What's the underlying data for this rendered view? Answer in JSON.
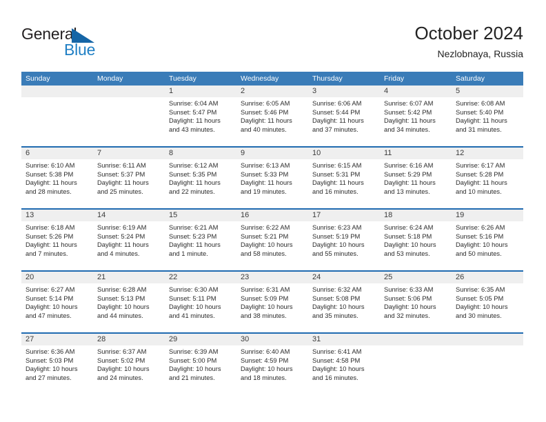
{
  "logo": {
    "word_one": "General",
    "word_two": "Blue",
    "triangle_color": "#1565a6",
    "blue_color": "#1f7fc4"
  },
  "header": {
    "title": "October 2024",
    "subtitle": "Nezlobnaya, Russia"
  },
  "theme": {
    "weekday_header_bg": "#3a7cb8",
    "week_separator": "#1f6ab0",
    "daynum_bg": "#efefef"
  },
  "weekdays": [
    "Sunday",
    "Monday",
    "Tuesday",
    "Wednesday",
    "Thursday",
    "Friday",
    "Saturday"
  ],
  "labels": {
    "sunrise": "Sunrise:",
    "sunset": "Sunset:",
    "daylight": "Daylight:"
  },
  "weeks": [
    [
      {
        "day": "",
        "sunrise": "",
        "sunset": "",
        "daylight": "",
        "empty": true
      },
      {
        "day": "",
        "sunrise": "",
        "sunset": "",
        "daylight": "",
        "empty": true
      },
      {
        "day": "1",
        "sunrise": "Sunrise: 6:04 AM",
        "sunset": "Sunset: 5:47 PM",
        "daylight": "Daylight: 11 hours and 43 minutes."
      },
      {
        "day": "2",
        "sunrise": "Sunrise: 6:05 AM",
        "sunset": "Sunset: 5:46 PM",
        "daylight": "Daylight: 11 hours and 40 minutes."
      },
      {
        "day": "3",
        "sunrise": "Sunrise: 6:06 AM",
        "sunset": "Sunset: 5:44 PM",
        "daylight": "Daylight: 11 hours and 37 minutes."
      },
      {
        "day": "4",
        "sunrise": "Sunrise: 6:07 AM",
        "sunset": "Sunset: 5:42 PM",
        "daylight": "Daylight: 11 hours and 34 minutes."
      },
      {
        "day": "5",
        "sunrise": "Sunrise: 6:08 AM",
        "sunset": "Sunset: 5:40 PM",
        "daylight": "Daylight: 11 hours and 31 minutes."
      }
    ],
    [
      {
        "day": "6",
        "sunrise": "Sunrise: 6:10 AM",
        "sunset": "Sunset: 5:38 PM",
        "daylight": "Daylight: 11 hours and 28 minutes."
      },
      {
        "day": "7",
        "sunrise": "Sunrise: 6:11 AM",
        "sunset": "Sunset: 5:37 PM",
        "daylight": "Daylight: 11 hours and 25 minutes."
      },
      {
        "day": "8",
        "sunrise": "Sunrise: 6:12 AM",
        "sunset": "Sunset: 5:35 PM",
        "daylight": "Daylight: 11 hours and 22 minutes."
      },
      {
        "day": "9",
        "sunrise": "Sunrise: 6:13 AM",
        "sunset": "Sunset: 5:33 PM",
        "daylight": "Daylight: 11 hours and 19 minutes."
      },
      {
        "day": "10",
        "sunrise": "Sunrise: 6:15 AM",
        "sunset": "Sunset: 5:31 PM",
        "daylight": "Daylight: 11 hours and 16 minutes."
      },
      {
        "day": "11",
        "sunrise": "Sunrise: 6:16 AM",
        "sunset": "Sunset: 5:29 PM",
        "daylight": "Daylight: 11 hours and 13 minutes."
      },
      {
        "day": "12",
        "sunrise": "Sunrise: 6:17 AM",
        "sunset": "Sunset: 5:28 PM",
        "daylight": "Daylight: 11 hours and 10 minutes."
      }
    ],
    [
      {
        "day": "13",
        "sunrise": "Sunrise: 6:18 AM",
        "sunset": "Sunset: 5:26 PM",
        "daylight": "Daylight: 11 hours and 7 minutes."
      },
      {
        "day": "14",
        "sunrise": "Sunrise: 6:19 AM",
        "sunset": "Sunset: 5:24 PM",
        "daylight": "Daylight: 11 hours and 4 minutes."
      },
      {
        "day": "15",
        "sunrise": "Sunrise: 6:21 AM",
        "sunset": "Sunset: 5:23 PM",
        "daylight": "Daylight: 11 hours and 1 minute."
      },
      {
        "day": "16",
        "sunrise": "Sunrise: 6:22 AM",
        "sunset": "Sunset: 5:21 PM",
        "daylight": "Daylight: 10 hours and 58 minutes."
      },
      {
        "day": "17",
        "sunrise": "Sunrise: 6:23 AM",
        "sunset": "Sunset: 5:19 PM",
        "daylight": "Daylight: 10 hours and 55 minutes."
      },
      {
        "day": "18",
        "sunrise": "Sunrise: 6:24 AM",
        "sunset": "Sunset: 5:18 PM",
        "daylight": "Daylight: 10 hours and 53 minutes."
      },
      {
        "day": "19",
        "sunrise": "Sunrise: 6:26 AM",
        "sunset": "Sunset: 5:16 PM",
        "daylight": "Daylight: 10 hours and 50 minutes."
      }
    ],
    [
      {
        "day": "20",
        "sunrise": "Sunrise: 6:27 AM",
        "sunset": "Sunset: 5:14 PM",
        "daylight": "Daylight: 10 hours and 47 minutes."
      },
      {
        "day": "21",
        "sunrise": "Sunrise: 6:28 AM",
        "sunset": "Sunset: 5:13 PM",
        "daylight": "Daylight: 10 hours and 44 minutes."
      },
      {
        "day": "22",
        "sunrise": "Sunrise: 6:30 AM",
        "sunset": "Sunset: 5:11 PM",
        "daylight": "Daylight: 10 hours and 41 minutes."
      },
      {
        "day": "23",
        "sunrise": "Sunrise: 6:31 AM",
        "sunset": "Sunset: 5:09 PM",
        "daylight": "Daylight: 10 hours and 38 minutes."
      },
      {
        "day": "24",
        "sunrise": "Sunrise: 6:32 AM",
        "sunset": "Sunset: 5:08 PM",
        "daylight": "Daylight: 10 hours and 35 minutes."
      },
      {
        "day": "25",
        "sunrise": "Sunrise: 6:33 AM",
        "sunset": "Sunset: 5:06 PM",
        "daylight": "Daylight: 10 hours and 32 minutes."
      },
      {
        "day": "26",
        "sunrise": "Sunrise: 6:35 AM",
        "sunset": "Sunset: 5:05 PM",
        "daylight": "Daylight: 10 hours and 30 minutes."
      }
    ],
    [
      {
        "day": "27",
        "sunrise": "Sunrise: 6:36 AM",
        "sunset": "Sunset: 5:03 PM",
        "daylight": "Daylight: 10 hours and 27 minutes."
      },
      {
        "day": "28",
        "sunrise": "Sunrise: 6:37 AM",
        "sunset": "Sunset: 5:02 PM",
        "daylight": "Daylight: 10 hours and 24 minutes."
      },
      {
        "day": "29",
        "sunrise": "Sunrise: 6:39 AM",
        "sunset": "Sunset: 5:00 PM",
        "daylight": "Daylight: 10 hours and 21 minutes."
      },
      {
        "day": "30",
        "sunrise": "Sunrise: 6:40 AM",
        "sunset": "Sunset: 4:59 PM",
        "daylight": "Daylight: 10 hours and 18 minutes."
      },
      {
        "day": "31",
        "sunrise": "Sunrise: 6:41 AM",
        "sunset": "Sunset: 4:58 PM",
        "daylight": "Daylight: 10 hours and 16 minutes."
      },
      {
        "day": "",
        "sunrise": "",
        "sunset": "",
        "daylight": "",
        "empty": true
      },
      {
        "day": "",
        "sunrise": "",
        "sunset": "",
        "daylight": "",
        "empty": true
      }
    ]
  ]
}
